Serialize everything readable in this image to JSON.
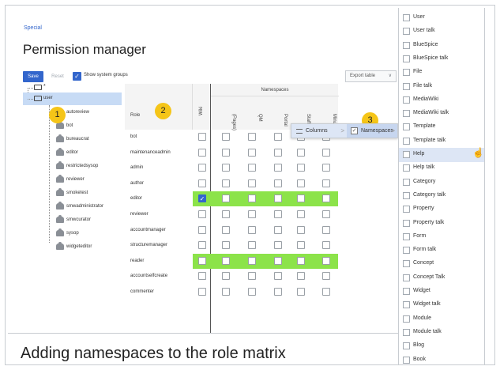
{
  "breadcrumb": "Special",
  "page_title": "Permission manager",
  "toolbar": {
    "save_label": "Save",
    "reset_label": "Reset",
    "show_system_groups_label": "Show system groups",
    "show_system_groups_checked": true,
    "export_label": "Export table"
  },
  "tree": {
    "root_label": "*",
    "user_label": "user",
    "groups": [
      "autoreview",
      "bot",
      "bureaucrat",
      "editor",
      "restrictedsysop",
      "reviewer",
      "smoketest",
      "smwadministrator",
      "smwcurator",
      "sysop",
      "widgeteditor"
    ]
  },
  "badges": [
    "1",
    "2",
    "3"
  ],
  "matrix": {
    "role_header": "Role",
    "wiki_header": "Wiki",
    "namespaces_header": "Namespaces",
    "namespace_columns": [
      "(Pages)",
      "QM",
      "Portal",
      "Staff",
      "Minutes"
    ],
    "roles": [
      {
        "name": "bot",
        "wiki": false,
        "highlight": false
      },
      {
        "name": "maintenanceadmin",
        "wiki": false,
        "highlight": false
      },
      {
        "name": "admin",
        "wiki": false,
        "highlight": false
      },
      {
        "name": "author",
        "wiki": false,
        "highlight": false
      },
      {
        "name": "editor",
        "wiki": true,
        "highlight": true
      },
      {
        "name": "reviewer",
        "wiki": false,
        "highlight": false
      },
      {
        "name": "accountmanager",
        "wiki": false,
        "highlight": false
      },
      {
        "name": "structuremanager",
        "wiki": false,
        "highlight": false
      },
      {
        "name": "reader",
        "wiki": false,
        "highlight": true
      },
      {
        "name": "accountselfcreate",
        "wiki": false,
        "highlight": false
      },
      {
        "name": "commenter",
        "wiki": false,
        "highlight": false
      }
    ],
    "highlight_color": "#8ce34a"
  },
  "context_menu": {
    "columns_label": "Columns",
    "namespaces_label": "Namespaces"
  },
  "namespace_list": {
    "items": [
      "User",
      "User talk",
      "BlueSpice",
      "BlueSpice talk",
      "File",
      "File talk",
      "MediaWiki",
      "MediaWiki talk",
      "Template",
      "Template talk",
      "Help",
      "Help talk",
      "Category",
      "Category talk",
      "Property",
      "Property talk",
      "Form",
      "Form talk",
      "Concept",
      "Concept Talk",
      "Widget",
      "Widget talk",
      "Module",
      "Module talk",
      "Blog",
      "Book"
    ],
    "active": "Help"
  },
  "caption": "Adding namespaces to the role matrix",
  "colors": {
    "accent": "#3366cc",
    "badge": "#f5c518"
  }
}
